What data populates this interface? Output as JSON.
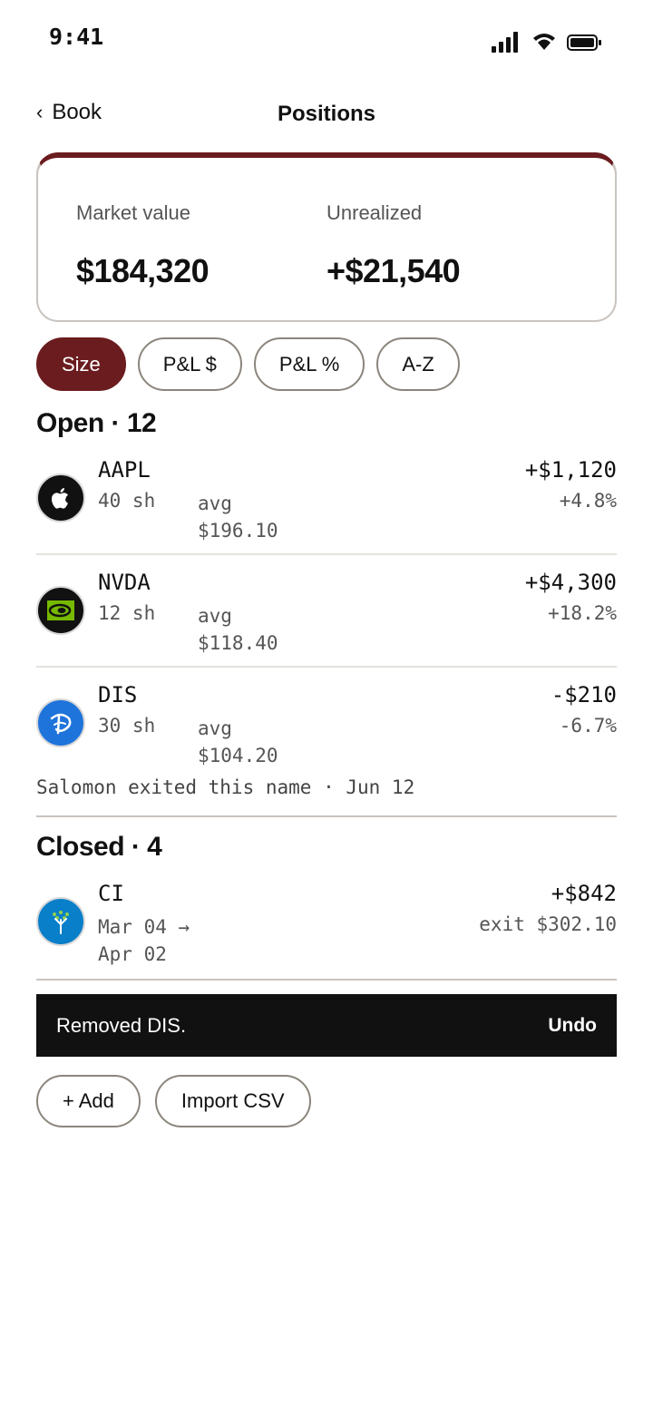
{
  "status_bar": {
    "time": "9:41"
  },
  "nav": {
    "back_label": "Book",
    "title": "Positions"
  },
  "summary": {
    "accent_color": "#6b1c1f",
    "market_value_label": "Market value",
    "market_value": "$184,320",
    "unrealized_label": "Unrealized",
    "unrealized": "+$21,540"
  },
  "sort_chips": [
    {
      "label": "Size",
      "active": true
    },
    {
      "label": "P&L $",
      "active": false
    },
    {
      "label": "P&L %",
      "active": false
    },
    {
      "label": "A-Z",
      "active": false
    }
  ],
  "open_section": {
    "title": "Open · 12"
  },
  "open_positions": [
    {
      "ticker": "AAPL",
      "shares": "40 sh",
      "avg_label": "avg",
      "avg_price": "$196.10",
      "pl": "+$1,120",
      "pct": "+4.8%",
      "icon": "apple-logo"
    },
    {
      "ticker": "NVDA",
      "shares": "12 sh",
      "avg_label": "avg",
      "avg_price": "$118.40",
      "pl": "+$4,300",
      "pct": "+18.2%",
      "icon": "nvidia-logo"
    },
    {
      "ticker": "DIS",
      "shares": "30 sh",
      "avg_label": "avg",
      "avg_price": "$104.20",
      "pl": "-$210",
      "pct": "-6.7%",
      "icon": "disney-logo"
    }
  ],
  "note": "Salomon exited this name · Jun 12",
  "closed_section": {
    "title": "Closed · 4"
  },
  "closed_positions": [
    {
      "ticker": "CI",
      "dates_line1": "Mar 04 →",
      "dates_line2": "Apr 02",
      "pl": "+$842",
      "exit": "exit $302.10",
      "icon": "cigna-logo"
    }
  ],
  "toast": {
    "message": "Removed DIS.",
    "action": "Undo"
  },
  "actions": {
    "add_label": "+ Add",
    "import_label": "Import CSV"
  }
}
